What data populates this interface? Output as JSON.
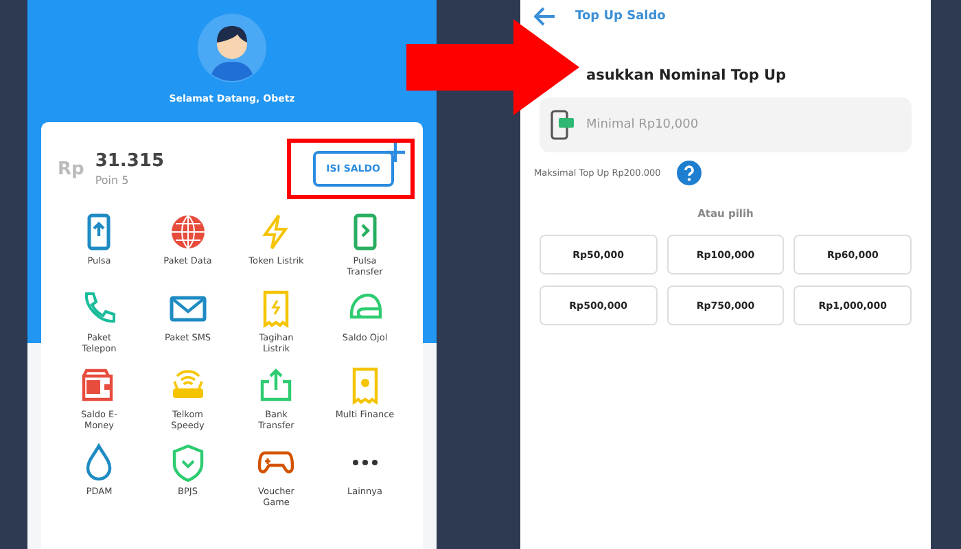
{
  "home": {
    "greeting": "Selamat Datang, Obetz",
    "balance": {
      "currency": "Rp",
      "amount": "31.315",
      "points": "Poin 5"
    },
    "topup_button": {
      "label": "ISI SALDO",
      "highlighted": true
    },
    "services": [
      {
        "kind": "phone-up",
        "label": "Pulsa"
      },
      {
        "kind": "globe",
        "label": "Paket Data"
      },
      {
        "kind": "bolt",
        "label": "Token Listrik"
      },
      {
        "kind": "phone-next",
        "label": "Pulsa Transfer"
      },
      {
        "kind": "call",
        "label": "Paket Telepon"
      },
      {
        "kind": "mail",
        "label": "Paket SMS"
      },
      {
        "kind": "bill",
        "label": "Tagihan Listrik"
      },
      {
        "kind": "helmet",
        "label": "Saldo Ojol"
      },
      {
        "kind": "wallet",
        "label": "Saldo E-Money"
      },
      {
        "kind": "router",
        "label": "Telkom Speedy"
      },
      {
        "kind": "transfer",
        "label": "Bank Transfer"
      },
      {
        "kind": "receipt",
        "label": "Multi Finance"
      },
      {
        "kind": "drop",
        "label": "PDAM"
      },
      {
        "kind": "shield",
        "label": "BPJS"
      },
      {
        "kind": "gamepad",
        "label": "Voucher Game"
      },
      {
        "kind": "dots",
        "label": "Lainnya"
      }
    ]
  },
  "topup": {
    "title": "Top Up Saldo",
    "heading": "asukkan Nominal Top Up",
    "amount_field": {
      "placeholder": "Minimal Rp10,000"
    },
    "max_note": "Maksimal Top Up Rp200.000",
    "choose_label": "Atau pilih",
    "options": [
      "Rp50,000",
      "Rp100,000",
      "Rp60,000",
      "Rp500,000",
      "Rp750,000",
      "Rp1,000,000"
    ]
  }
}
